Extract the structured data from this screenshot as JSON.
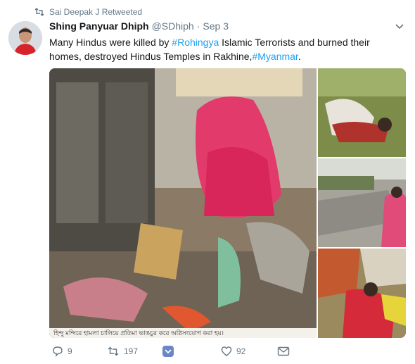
{
  "retweet_context": {
    "label": "Sai Deepak J Retweeted",
    "icon": "retweet-icon"
  },
  "tweet": {
    "author_name": "Shing Panyuar Dhiph",
    "author_handle": "@SDhiph",
    "separator": "·",
    "timestamp": "Sep 3",
    "text_segments": [
      {
        "text": "Many Hindus were killed by ",
        "type": "plain"
      },
      {
        "text": "#Rohingya",
        "type": "hashtag"
      },
      {
        "text": " Islamic Terrorists and burned their homes, destroyed Hindus Temples in Rakhine,",
        "type": "plain"
      },
      {
        "text": "#Myanmar",
        "type": "hashtag"
      },
      {
        "text": ".",
        "type": "plain"
      }
    ],
    "media_caption": "হিন্দু মন্দিরে হামলা চালিয়ে প্রতিমা ভাঙচুর করে অগ্নিসংযোগ করা হয়।"
  },
  "actions": {
    "reply_count": "9",
    "retweet_count": "197",
    "like_count": "92"
  },
  "colors": {
    "accent": "#1da1f2",
    "secondary_text": "#657786",
    "primary_text": "#14171a",
    "share_icon_bg": "#6b86c4"
  }
}
